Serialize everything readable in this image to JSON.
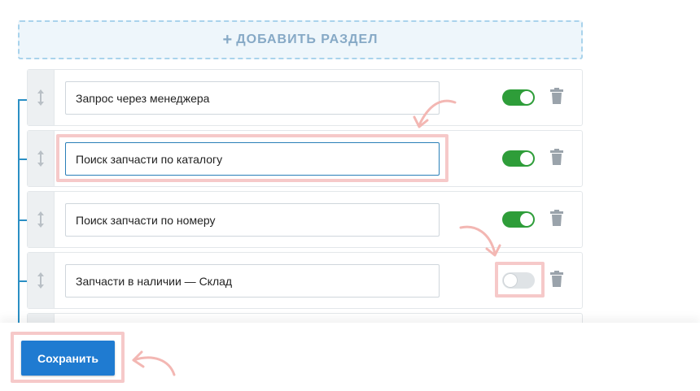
{
  "add_section": {
    "plus": "+",
    "label": "ДОБАВИТЬ РАЗДЕЛ"
  },
  "sections": [
    {
      "name": "Запрос через менеджера",
      "enabled": true
    },
    {
      "name": "Поиск запчасти по каталогу",
      "enabled": true,
      "focused": true
    },
    {
      "name": "Поиск запчасти по номеру",
      "enabled": true
    },
    {
      "name": "Запчасти в наличии — Склад",
      "enabled": false
    }
  ],
  "save_button": {
    "label": "Сохранить"
  },
  "colors": {
    "toggle_on": "#2e9d39",
    "toggle_off": "#dfe3e6",
    "primary": "#1f7bd1",
    "highlight": "#f6c9c9",
    "tree_line": "#2a8fc4"
  },
  "icons": {
    "drag_handle": "vertical-arrows-icon",
    "delete": "trash-icon",
    "add": "plus-icon",
    "annotation": "curved-arrow-icon"
  }
}
